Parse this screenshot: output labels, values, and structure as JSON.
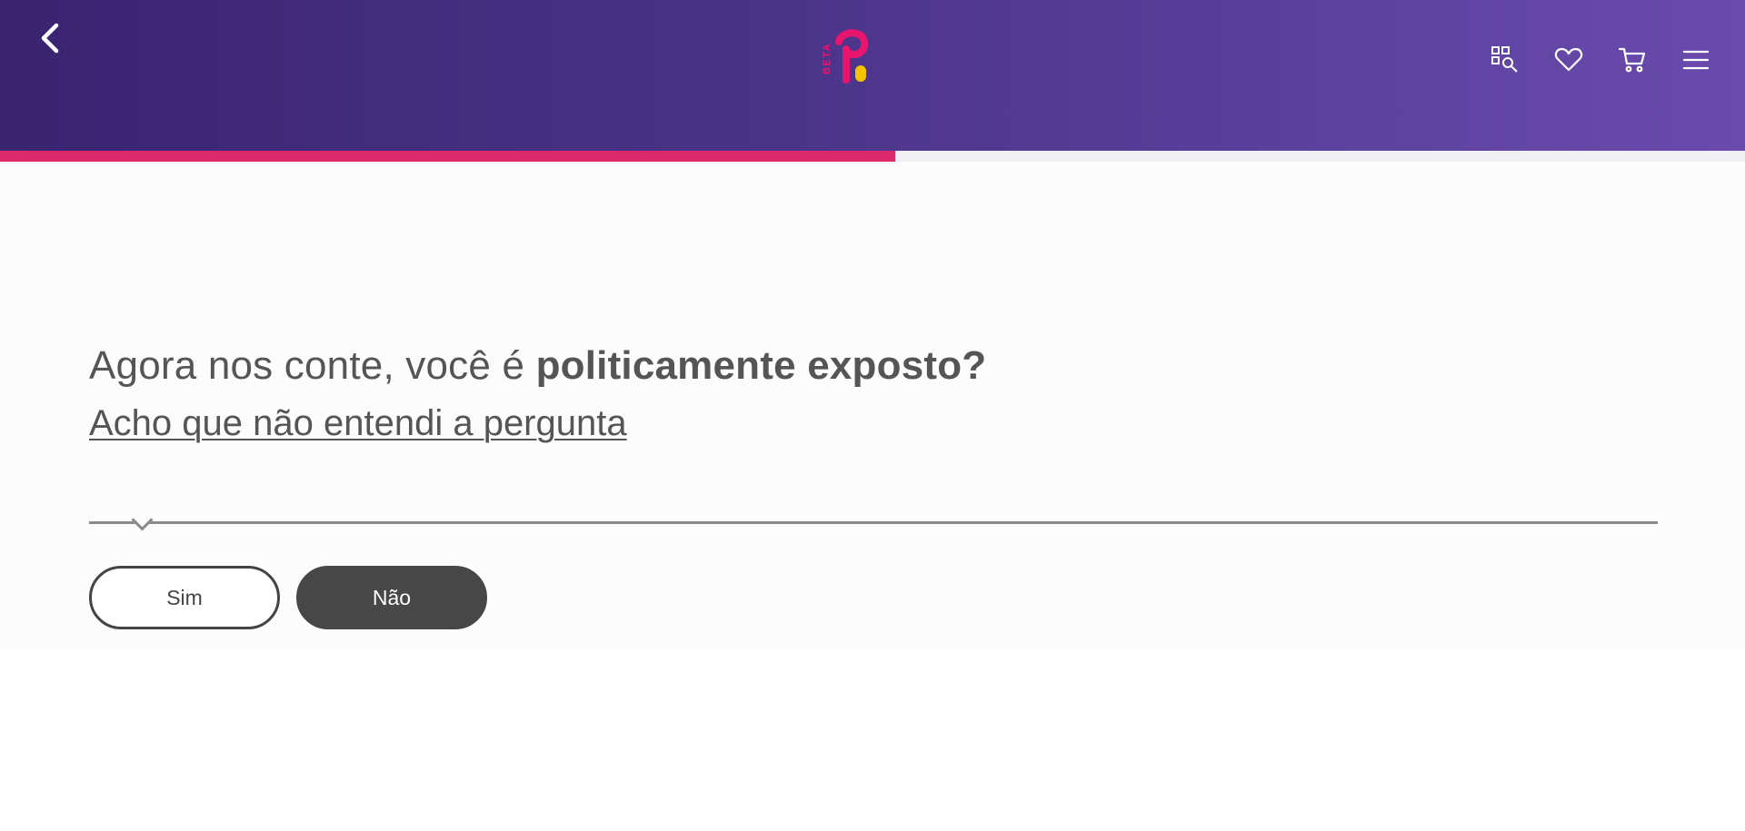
{
  "header": {
    "logo_badge": "BETA",
    "icons": {
      "back": "chevron-left-icon",
      "search": "grid-search-icon",
      "favorites": "heart-icon",
      "cart": "cart-icon",
      "menu": "hamburger-menu-icon"
    }
  },
  "progress": {
    "value": 0.513,
    "color": "#d9296a"
  },
  "question": {
    "prefix": "Agora nos conte, você é ",
    "emphasis": "politicamente exposto?",
    "help_link": "Acho que não entendi a pergunta"
  },
  "answers": {
    "yes_label": "Sim",
    "no_label": "Não"
  },
  "colors": {
    "header_gradient_start": "#3a2470",
    "header_gradient_end": "#6a4bae",
    "accent": "#d9296a",
    "logo_yellow": "#f5c400",
    "text": "#555555"
  }
}
